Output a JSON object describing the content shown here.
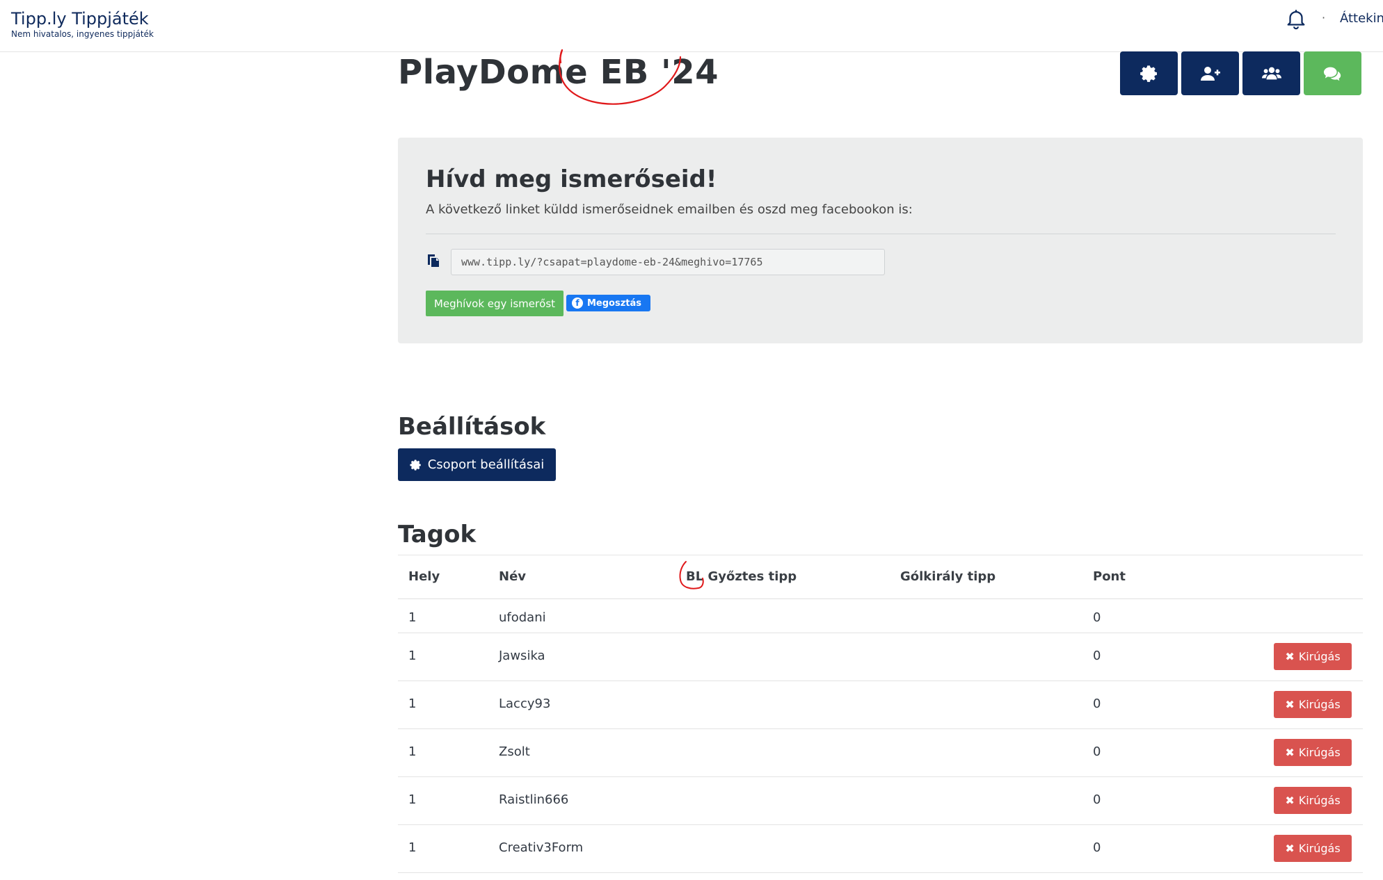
{
  "navbar": {
    "brand_title": "Tipp.ly Tippjáték",
    "brand_subtitle": "Nem hivatalos, ingyenes tippjáték",
    "separator": "·",
    "overview_link": "Áttekint"
  },
  "page": {
    "title": "PlayDome EB '24"
  },
  "actions": {
    "icons": [
      "gear-icon",
      "user-plus-icon",
      "users-icon",
      "comments-icon"
    ]
  },
  "invite": {
    "title": "Hívd meg ismerőseid!",
    "description": "A következő linket küldd ismerőseidnek emailben és oszd meg facebookon is:",
    "link": "www.tipp.ly/?csapat=playdome-eb-24&meghivo=17765",
    "invite_button": "Meghívok egy ismerőst",
    "share_button": "Megosztás"
  },
  "settings": {
    "heading": "Beállítások",
    "button": "Csoport beállításai"
  },
  "members": {
    "heading": "Tagok",
    "columns": [
      "Hely",
      "Név",
      "BL Győztes tipp",
      "Gólkirály tipp",
      "Pont"
    ],
    "kick_label": "Kirúgás",
    "rows": [
      {
        "place": "1",
        "name": "ufodani",
        "winner": "",
        "topscorer": "",
        "points": "0",
        "kick": false
      },
      {
        "place": "1",
        "name": "Jawsika",
        "winner": "",
        "topscorer": "",
        "points": "0",
        "kick": true
      },
      {
        "place": "1",
        "name": "Laccy93",
        "winner": "",
        "topscorer": "",
        "points": "0",
        "kick": true
      },
      {
        "place": "1",
        "name": "Zsolt",
        "winner": "",
        "topscorer": "",
        "points": "0",
        "kick": true
      },
      {
        "place": "1",
        "name": "Raistlin666",
        "winner": "",
        "topscorer": "",
        "points": "0",
        "kick": true
      },
      {
        "place": "1",
        "name": "Creativ3Form",
        "winner": "",
        "topscorer": "",
        "points": "0",
        "kick": true
      }
    ]
  },
  "colors": {
    "navy": "#0d2a5e",
    "green": "#5cb85c",
    "red": "#d9534f",
    "facebook": "#1877f2",
    "annotation": "#e0191b"
  }
}
